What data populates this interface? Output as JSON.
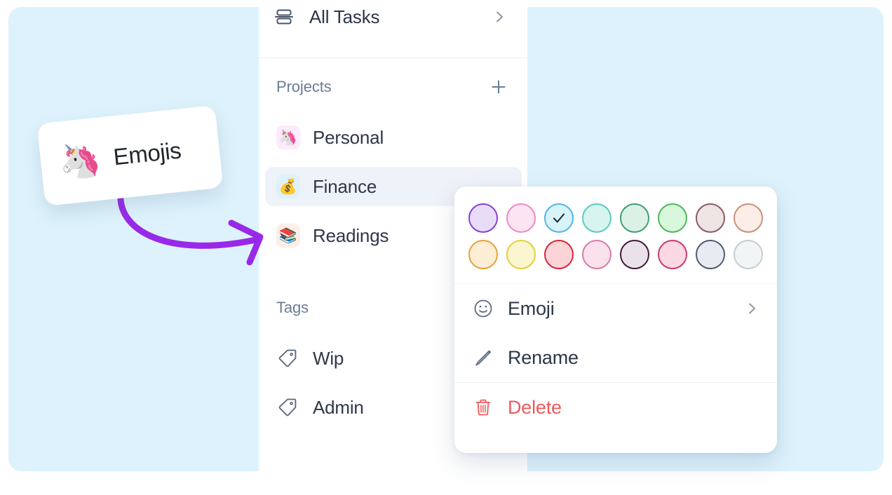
{
  "background": {
    "panel_color": "#ddf2fc",
    "page_color": "#ffffff"
  },
  "sidebar": {
    "all_tasks": {
      "label": "All Tasks",
      "icon": "all-tasks-icon",
      "chevron": "chevron-right-icon"
    },
    "projects_section": {
      "title": "Projects",
      "add_icon": "plus-icon",
      "items": [
        {
          "label": "Personal",
          "emoji": "🦄",
          "badge_color": "#fdeafb",
          "selected": false
        },
        {
          "label": "Finance",
          "emoji": "💰",
          "badge_color": "#dff1fa",
          "selected": true
        },
        {
          "label": "Readings",
          "emoji": "📚",
          "badge_color": "#fdeee7",
          "selected": false
        }
      ]
    },
    "tags_section": {
      "title": "Tags",
      "items": [
        {
          "label": "Wip",
          "icon": "tag-icon"
        },
        {
          "label": "Admin",
          "icon": "tag-icon"
        }
      ]
    }
  },
  "callout": {
    "emoji": "🦄",
    "text": "Emojis",
    "arrow_color": "#9929e8"
  },
  "context_menu": {
    "selected_swatch_index": 2,
    "check_icon": "check-icon",
    "swatches": [
      {
        "name": "purple",
        "fill": "#e7ddf8",
        "border": "#8b3fd4"
      },
      {
        "name": "pink",
        "fill": "#fce4f2",
        "border": "#f08ac5"
      },
      {
        "name": "sky",
        "fill": "#d9f3fb",
        "border": "#4eb7e8",
        "selected": true
      },
      {
        "name": "turquoise",
        "fill": "#d7f4ef",
        "border": "#5ccac3"
      },
      {
        "name": "mint",
        "fill": "#dbf1e6",
        "border": "#3f9e72"
      },
      {
        "name": "green",
        "fill": "#d9f7da",
        "border": "#4cb75c"
      },
      {
        "name": "mauve",
        "fill": "#eee4e4",
        "border": "#8a5a62"
      },
      {
        "name": "peach",
        "fill": "#fbeee7",
        "border": "#c98f79"
      },
      {
        "name": "orange",
        "fill": "#fdeed5",
        "border": "#e8a13e"
      },
      {
        "name": "yellow",
        "fill": "#fbf6cf",
        "border": "#e2d13e"
      },
      {
        "name": "red",
        "fill": "#fcd4d7",
        "border": "#d6283a"
      },
      {
        "name": "rose",
        "fill": "#fbe1ec",
        "border": "#d97ba8"
      },
      {
        "name": "plum",
        "fill": "#eae2ea",
        "border": "#3f1b3a"
      },
      {
        "name": "magenta",
        "fill": "#fcd7e4",
        "border": "#c83a6e"
      },
      {
        "name": "slate",
        "fill": "#e6ecf1",
        "border": "#4d5a71"
      },
      {
        "name": "light-gray",
        "fill": "#f1f5f6",
        "border": "#c6cdd2"
      }
    ],
    "items": [
      {
        "label": "Emoji",
        "icon": "smiley-icon",
        "chevron": "chevron-right-icon",
        "danger": false
      },
      {
        "label": "Rename",
        "icon": "pencil-icon",
        "chevron": "",
        "danger": false
      },
      {
        "label": "Delete",
        "icon": "trash-icon",
        "chevron": "",
        "danger": true
      }
    ],
    "danger_color": "#ef5a5a"
  }
}
